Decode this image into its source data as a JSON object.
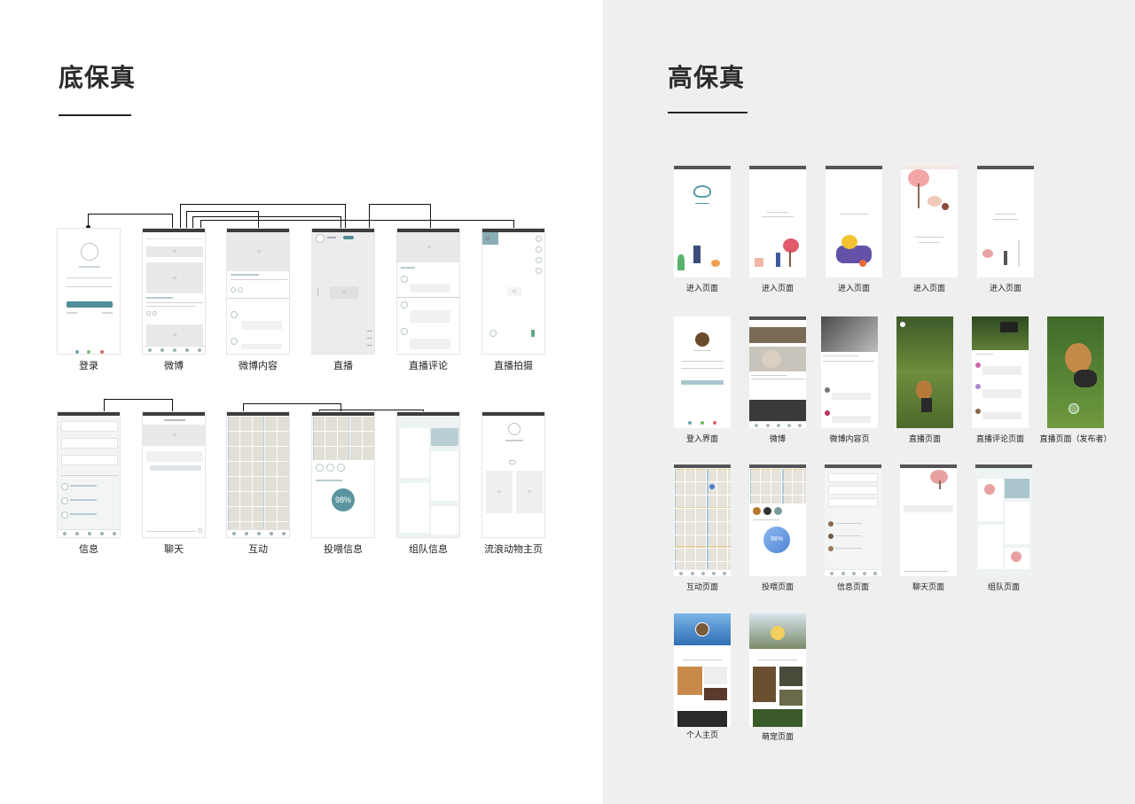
{
  "low_fidelity": {
    "title": "底保真",
    "row1": [
      "登录",
      "微博",
      "微博内容",
      "直播",
      "直播评论",
      "直播拍摄"
    ],
    "row2": [
      "信息",
      "聊天",
      "互动",
      "投喂信息",
      "组队信息",
      "流浪动物主页"
    ],
    "progress_text": "98%"
  },
  "high_fidelity": {
    "title": "高保真",
    "row1": [
      "进入页面",
      "进入页面",
      "进入页面",
      "进入页面",
      "进入页面"
    ],
    "row2": [
      "登入界面",
      "微博",
      "微博内容页",
      "直播页面",
      "直播评论页面",
      "直播页面（发布者）"
    ],
    "row3": [
      "互动页面",
      "投喂页面",
      "信息页面",
      "聊天页面",
      "组队页面"
    ],
    "row4": [
      "个人主页",
      "萌宠页面"
    ],
    "progress_text": "98%"
  },
  "colors": {
    "accent": "#4f8d98",
    "right_background": "#efefef",
    "status_bar": "#3d3d3d"
  }
}
